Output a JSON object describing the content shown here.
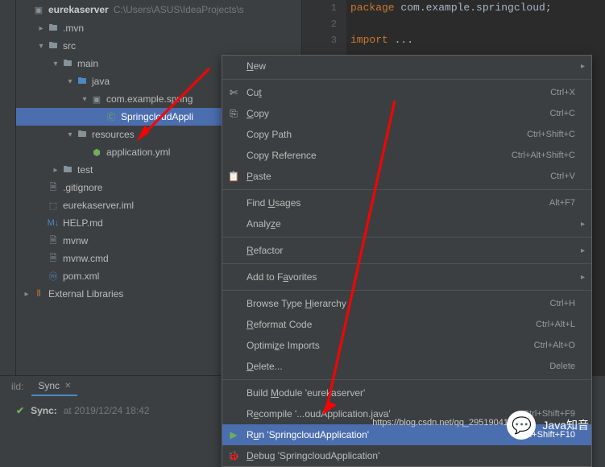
{
  "project": {
    "name": "eurekaserver",
    "path": "C:\\Users\\ASUS\\IdeaProjects\\s"
  },
  "tree": {
    "mvn": ".mvn",
    "src": "src",
    "main": "main",
    "java": "java",
    "package": "com.example.spring",
    "app_class": "SpringcloudAppli",
    "resources": "resources",
    "app_yml": "application.yml",
    "test": "test",
    "gitignore": ".gitignore",
    "iml": "eurekaserver.iml",
    "help_md": "HELP.md",
    "mvnw": "mvnw",
    "mvnw_cmd": "mvnw.cmd",
    "pom_xml": "pom.xml",
    "ext_libs": "External Libraries"
  },
  "editor": {
    "line1_kw": "package",
    "line1_pkg": " com.example.springcloud;",
    "line3_kw": "import",
    "line3_rest": " ..."
  },
  "menu": {
    "new": "New",
    "cut": "Cut",
    "cut_key": "Ctrl+X",
    "copy": "Copy",
    "copy_key": "Ctrl+C",
    "copy_path": "Copy Path",
    "copy_path_key": "Ctrl+Shift+C",
    "copy_ref": "Copy Reference",
    "copy_ref_key": "Ctrl+Alt+Shift+C",
    "paste": "Paste",
    "paste_key": "Ctrl+V",
    "find_usages": "Find Usages",
    "find_usages_key": "Alt+F7",
    "analyze": "Analyze",
    "refactor": "Refactor",
    "favorites": "Add to Favorites",
    "browse_hier": "Browse Type Hierarchy",
    "browse_hier_key": "Ctrl+H",
    "reformat": "Reformat Code",
    "reformat_key": "Ctrl+Alt+L",
    "optimize": "Optimize Imports",
    "optimize_key": "Ctrl+Alt+O",
    "delete": "Delete...",
    "delete_key": "Delete",
    "build_module": "Build Module 'eurekaserver'",
    "recompile": "Recompile '...oudApplication.java'",
    "recompile_key": "Ctrl+Shift+F9",
    "run": "Run 'SpringcloudApplication'",
    "run_key": "Ctrl+Shift+F10",
    "debug": "Debug 'SpringcloudApplication'"
  },
  "bottom": {
    "build_label": "ild:",
    "tab_sync": "Sync",
    "sync_label": "Sync:",
    "sync_time": "at 2019/12/24 18:42"
  },
  "watermark": {
    "text": "Java知音",
    "url": "https://blog.csdn.net/qq_29519041"
  }
}
